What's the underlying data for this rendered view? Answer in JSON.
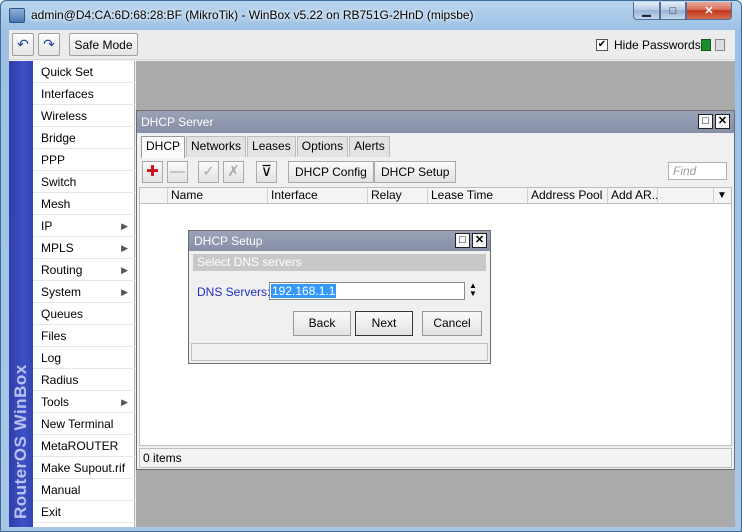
{
  "window": {
    "title": "admin@D4:CA:6D:68:28:BF (MikroTik) - WinBox v5.22 on RB751G-2HnD (mipsbe)",
    "min_glyph": "▁",
    "max_glyph": "□",
    "close_glyph": "✕"
  },
  "toolbar": {
    "undo_glyph": "↶",
    "redo_glyph": "↷",
    "safe_mode_label": "Safe Mode",
    "hide_passwords_checked": "✔",
    "hide_passwords_label": "Hide Passwords"
  },
  "sidebar": {
    "brand": "RouterOS WinBox",
    "items": [
      {
        "label": "Quick Set",
        "arrow": ""
      },
      {
        "label": "Interfaces",
        "arrow": ""
      },
      {
        "label": "Wireless",
        "arrow": ""
      },
      {
        "label": "Bridge",
        "arrow": ""
      },
      {
        "label": "PPP",
        "arrow": ""
      },
      {
        "label": "Switch",
        "arrow": ""
      },
      {
        "label": "Mesh",
        "arrow": ""
      },
      {
        "label": "IP",
        "arrow": "▶"
      },
      {
        "label": "MPLS",
        "arrow": "▶"
      },
      {
        "label": "Routing",
        "arrow": "▶"
      },
      {
        "label": "System",
        "arrow": "▶"
      },
      {
        "label": "Queues",
        "arrow": ""
      },
      {
        "label": "Files",
        "arrow": ""
      },
      {
        "label": "Log",
        "arrow": ""
      },
      {
        "label": "Radius",
        "arrow": ""
      },
      {
        "label": "Tools",
        "arrow": "▶"
      },
      {
        "label": "New Terminal",
        "arrow": ""
      },
      {
        "label": "MetaROUTER",
        "arrow": ""
      },
      {
        "label": "Make Supout.rif",
        "arrow": ""
      },
      {
        "label": "Manual",
        "arrow": ""
      },
      {
        "label": "Exit",
        "arrow": ""
      }
    ]
  },
  "dhcp_window": {
    "title": "DHCP Server",
    "tabs": [
      "DHCP",
      "Networks",
      "Leases",
      "Options",
      "Alerts"
    ],
    "active_tab": "DHCP",
    "add_glyph": "✚",
    "remove_glyph": "—",
    "enable_glyph": "✓",
    "disable_glyph": "✗",
    "filter_glyph": "⊽",
    "dhcp_config_label": "DHCP Config",
    "dhcp_setup_label": "DHCP Setup",
    "find_placeholder": "Find",
    "columns": [
      "Name",
      "Interface",
      "Relay",
      "Lease Time",
      "Address Pool",
      "Add AR..."
    ],
    "sort_glyph": "/",
    "dropdown_glyph": "▼",
    "status": "0 items"
  },
  "setup_dialog": {
    "title": "DHCP Setup",
    "subtitle": "Select DNS servers",
    "dns_label": "DNS Servers:",
    "dns_value": "192.168.1.1",
    "updown_glyph": "▲▼",
    "back_label": "Back",
    "next_label": "Next",
    "cancel_label": "Cancel"
  }
}
